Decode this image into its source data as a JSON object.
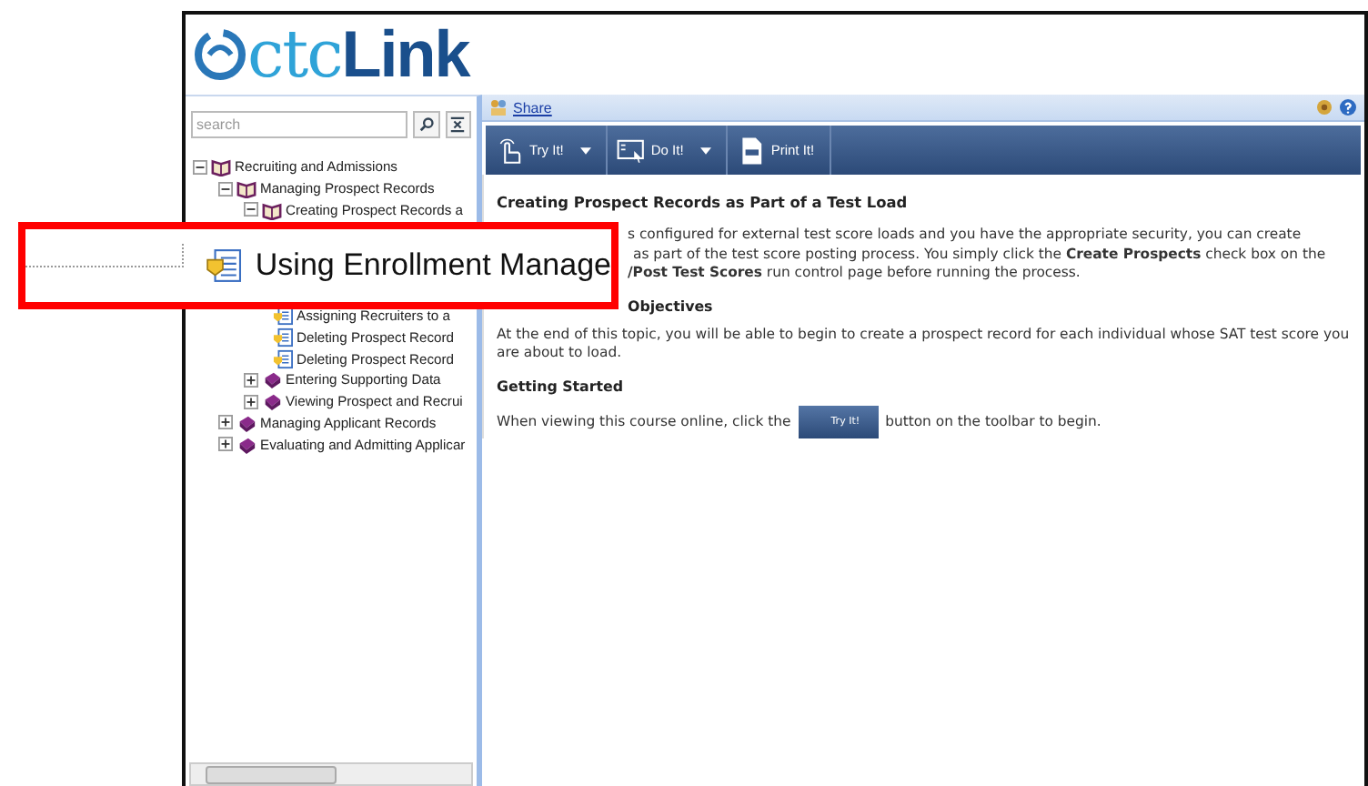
{
  "logo": {
    "text": "ctc**Link**"
  },
  "sidebar": {
    "search": {
      "placeholder": "search"
    },
    "tree": [
      {
        "label": "Recruiting and Admissions",
        "kind": "book",
        "expanded": true,
        "children": [
          {
            "label": "Managing Prospect Records",
            "kind": "book",
            "expanded": true,
            "children": [
              {
                "label": "Creating Prospect Records a",
                "kind": "book",
                "expanded": true,
                "occluded_below": true,
                "children": [
                  {
                    "label": "Assigning Recruiters to a",
                    "kind": "topic"
                  },
                  {
                    "label": "Deleting Prospect Record",
                    "kind": "topic"
                  },
                  {
                    "label": "Deleting Prospect Record",
                    "kind": "topic"
                  }
                ]
              },
              {
                "label": "Entering Supporting Data",
                "kind": "book",
                "expanded": false
              },
              {
                "label": "Viewing Prospect and Recrui",
                "kind": "book",
                "expanded": false
              }
            ]
          },
          {
            "label": "Managing Applicant Records",
            "kind": "book",
            "expanded": false
          },
          {
            "label": "Evaluating and Admitting Applicar",
            "kind": "book",
            "expanded": false
          }
        ]
      }
    ]
  },
  "content": {
    "share": "Share",
    "toolbar": [
      {
        "label": "Try It!",
        "kind": "try",
        "dropdown": true
      },
      {
        "label": "Do It!",
        "kind": "do",
        "dropdown": true
      },
      {
        "label": "Print It!",
        "kind": "print",
        "dropdown": false
      }
    ],
    "title": "Creating Prospect Records as Part of a Test Load",
    "covered_lines": [
      "s configured for external test score loads and you have the appropriate security, you can create",
      "as part of the test score posting process. You simply click the **Create Prospects** check box on the",
      "**/Post Test Scores** run control page before running the process."
    ],
    "covered_heading": "Objectives",
    "objectives": "At the end of this topic, you will be able to begin to create a prospect record for each individual whose SAT test score you are about to load.",
    "heading": "Getting Started",
    "instruction_before": "When viewing this course online, click the",
    "inline_button": "Try It!",
    "instruction_after": "button on the toolbar to begin."
  },
  "callout": {
    "label": "Using Enrollment Manage"
  }
}
